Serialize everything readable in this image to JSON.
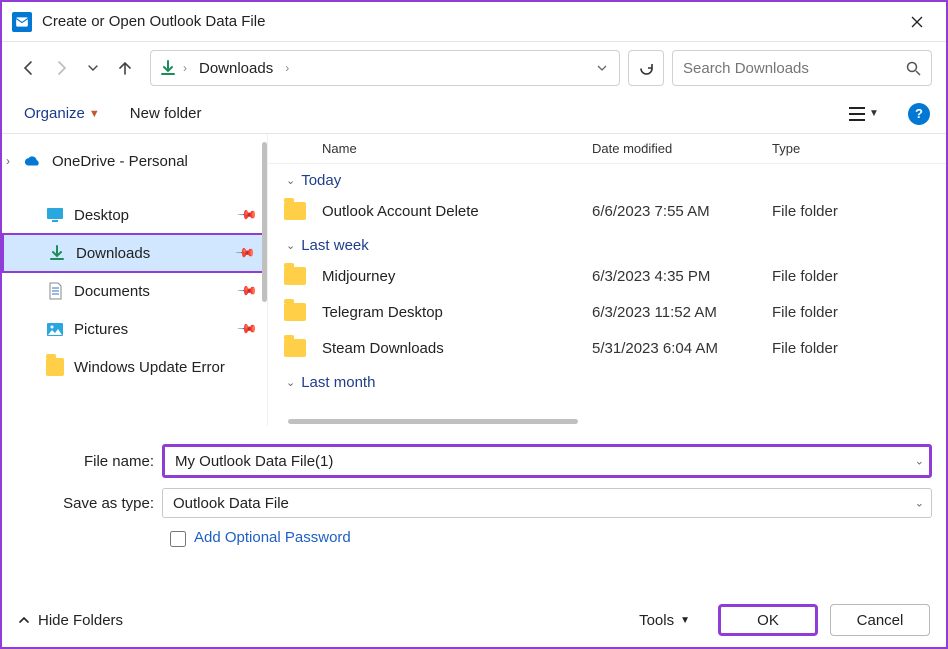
{
  "window": {
    "title": "Create or Open Outlook Data File"
  },
  "nav": {
    "breadcrumb": [
      "Downloads"
    ]
  },
  "search": {
    "placeholder": "Search Downloads"
  },
  "toolbar": {
    "organize": "Organize",
    "new_folder": "New folder"
  },
  "sidebar": {
    "items": [
      {
        "label": "OneDrive - Personal",
        "icon": "onedrive",
        "chevron": true
      },
      {
        "label": "Desktop",
        "icon": "desktop",
        "pinned": true,
        "indent": true
      },
      {
        "label": "Downloads",
        "icon": "downloads",
        "pinned": true,
        "indent": true,
        "selected": true
      },
      {
        "label": "Documents",
        "icon": "documents",
        "pinned": true,
        "indent": true
      },
      {
        "label": "Pictures",
        "icon": "pictures",
        "pinned": true,
        "indent": true
      },
      {
        "label": "Windows Update Error",
        "icon": "folder",
        "indent": true
      }
    ]
  },
  "columns": {
    "name": "Name",
    "date": "Date modified",
    "type": "Type"
  },
  "groups": [
    {
      "label": "Today",
      "rows": [
        {
          "name": "Outlook Account Delete",
          "date": "6/6/2023 7:55 AM",
          "type": "File folder"
        }
      ]
    },
    {
      "label": "Last week",
      "rows": [
        {
          "name": "Midjourney",
          "date": "6/3/2023 4:35 PM",
          "type": "File folder"
        },
        {
          "name": "Telegram Desktop",
          "date": "6/3/2023 11:52 AM",
          "type": "File folder"
        },
        {
          "name": "Steam Downloads",
          "date": "5/31/2023 6:04 AM",
          "type": "File folder"
        }
      ]
    },
    {
      "label": "Last month",
      "rows": []
    }
  ],
  "save": {
    "filename_label": "File name:",
    "filename_value": "My Outlook Data File(1)",
    "type_label": "Save as type:",
    "type_value": "Outlook Data File",
    "optional_pw": "Add Optional Password"
  },
  "footer": {
    "hide": "Hide Folders",
    "tools": "Tools",
    "ok": "OK",
    "cancel": "Cancel"
  }
}
